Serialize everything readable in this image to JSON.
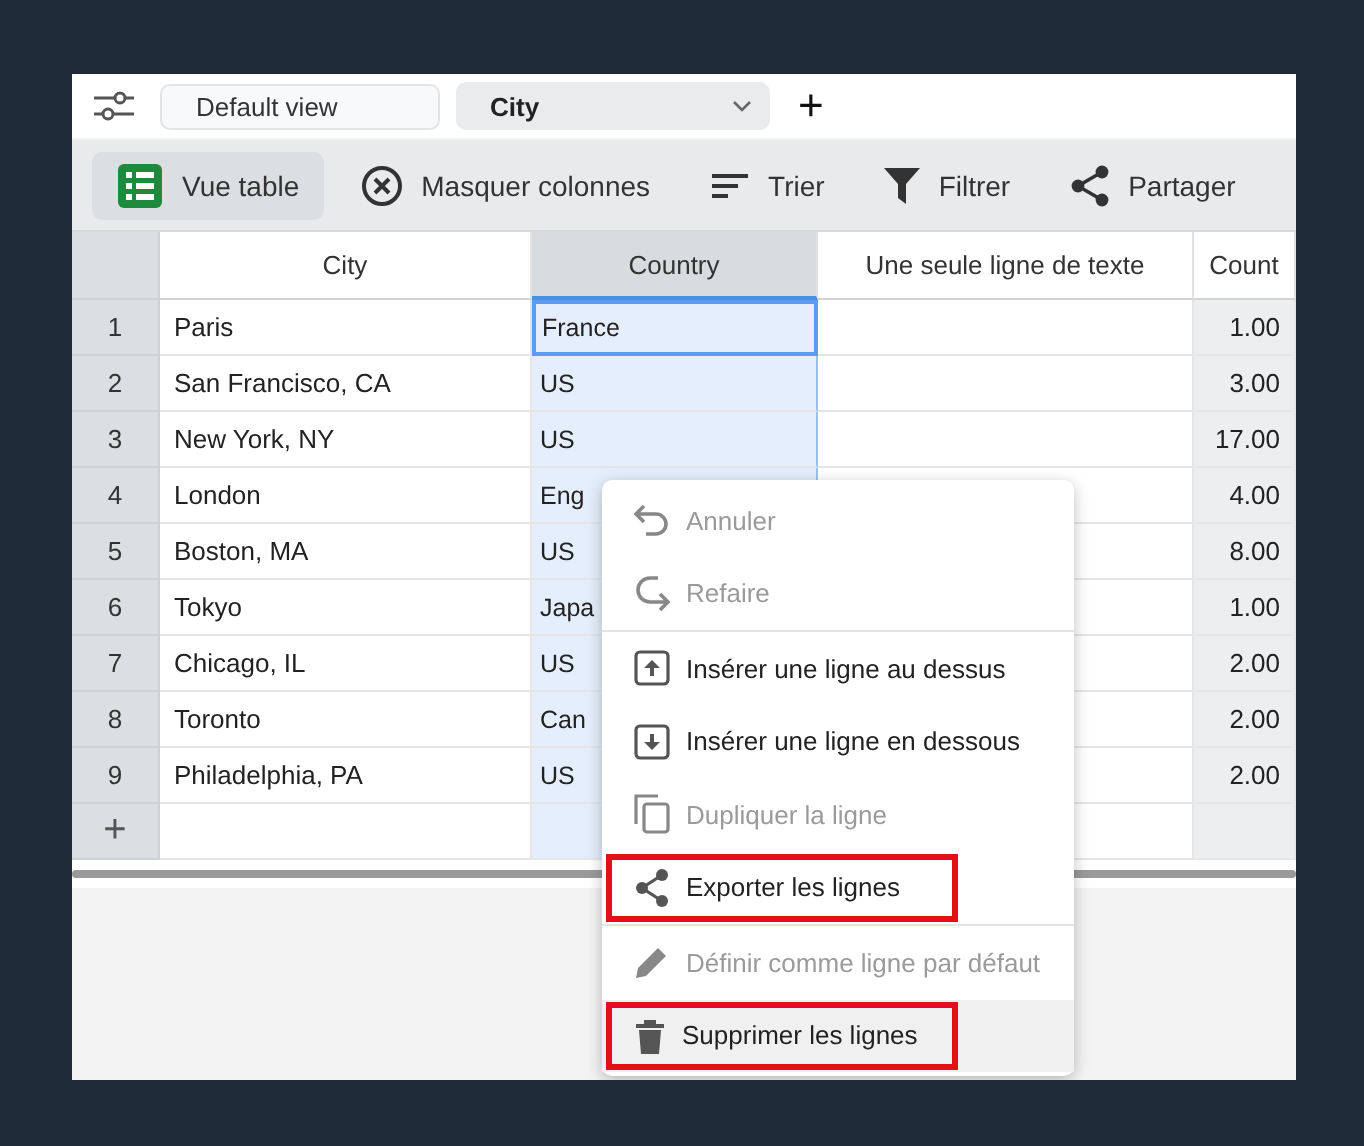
{
  "top_bar": {
    "view_name": "Default view",
    "table_select": "City",
    "add_label": "+"
  },
  "toolbar": [
    {
      "label": "Vue table",
      "kind": "grid",
      "selected": true
    },
    {
      "label": "Masquer colonnes",
      "kind": "hide",
      "selected": false
    },
    {
      "label": "Trier",
      "kind": "sort",
      "selected": false
    },
    {
      "label": "Filtrer",
      "kind": "filter",
      "selected": false
    },
    {
      "label": "Partager",
      "kind": "share",
      "selected": false
    }
  ],
  "table": {
    "columns": [
      {
        "label": "City",
        "selected": false
      },
      {
        "label": "Country",
        "selected": true
      },
      {
        "label": "Une seule ligne de texte",
        "selected": false
      },
      {
        "label": "Count",
        "selected": false
      }
    ],
    "rows": [
      {
        "number": "1",
        "city": "Paris",
        "country": "France",
        "count": "1.00",
        "active": true
      },
      {
        "number": "2",
        "city": "San Francisco, CA",
        "country": "US",
        "count": "3.00",
        "active": false
      },
      {
        "number": "3",
        "city": "New York, NY",
        "country": "US",
        "count": "17.00",
        "active": false
      },
      {
        "number": "4",
        "city": "London",
        "country": "Eng",
        "count": "4.00",
        "active": false
      },
      {
        "number": "5",
        "city": "Boston, MA",
        "country": "US",
        "count": "8.00",
        "active": false
      },
      {
        "number": "6",
        "city": "Tokyo",
        "country": "Japa",
        "count": "1.00",
        "active": false
      },
      {
        "number": "7",
        "city": "Chicago, IL",
        "country": "US",
        "count": "2.00",
        "active": false
      },
      {
        "number": "8",
        "city": "Toronto",
        "country": "Can",
        "count": "2.00",
        "active": false
      },
      {
        "number": "9",
        "city": "Philadelphia, PA",
        "country": "US",
        "count": "2.00",
        "active": false
      }
    ],
    "add_row": "+"
  },
  "context_menu": {
    "groups": [
      [
        {
          "label": "Annuler",
          "kind": "undo",
          "disabled": true,
          "highlighted": false,
          "hovered": false
        },
        {
          "label": "Refaire",
          "kind": "redo",
          "disabled": true,
          "highlighted": false,
          "hovered": false
        }
      ],
      [
        {
          "label": "Insérer une ligne au dessus",
          "kind": "insert_above",
          "disabled": false,
          "highlighted": false,
          "hovered": false
        },
        {
          "label": "Insérer une ligne en dessous",
          "kind": "insert_below",
          "disabled": false,
          "highlighted": false,
          "hovered": false
        },
        {
          "label": "Dupliquer la ligne",
          "kind": "duplicate",
          "disabled": true,
          "highlighted": false,
          "hovered": false
        },
        {
          "label": "Exporter les lignes",
          "kind": "share",
          "disabled": false,
          "highlighted": true,
          "hovered": false
        }
      ],
      [
        {
          "label": "Définir comme ligne par défaut",
          "kind": "edit",
          "disabled": true,
          "highlighted": false,
          "hovered": false
        },
        {
          "label": "Supprimer les lignes",
          "kind": "delete",
          "disabled": false,
          "highlighted": true,
          "hovered": true
        }
      ]
    ]
  }
}
